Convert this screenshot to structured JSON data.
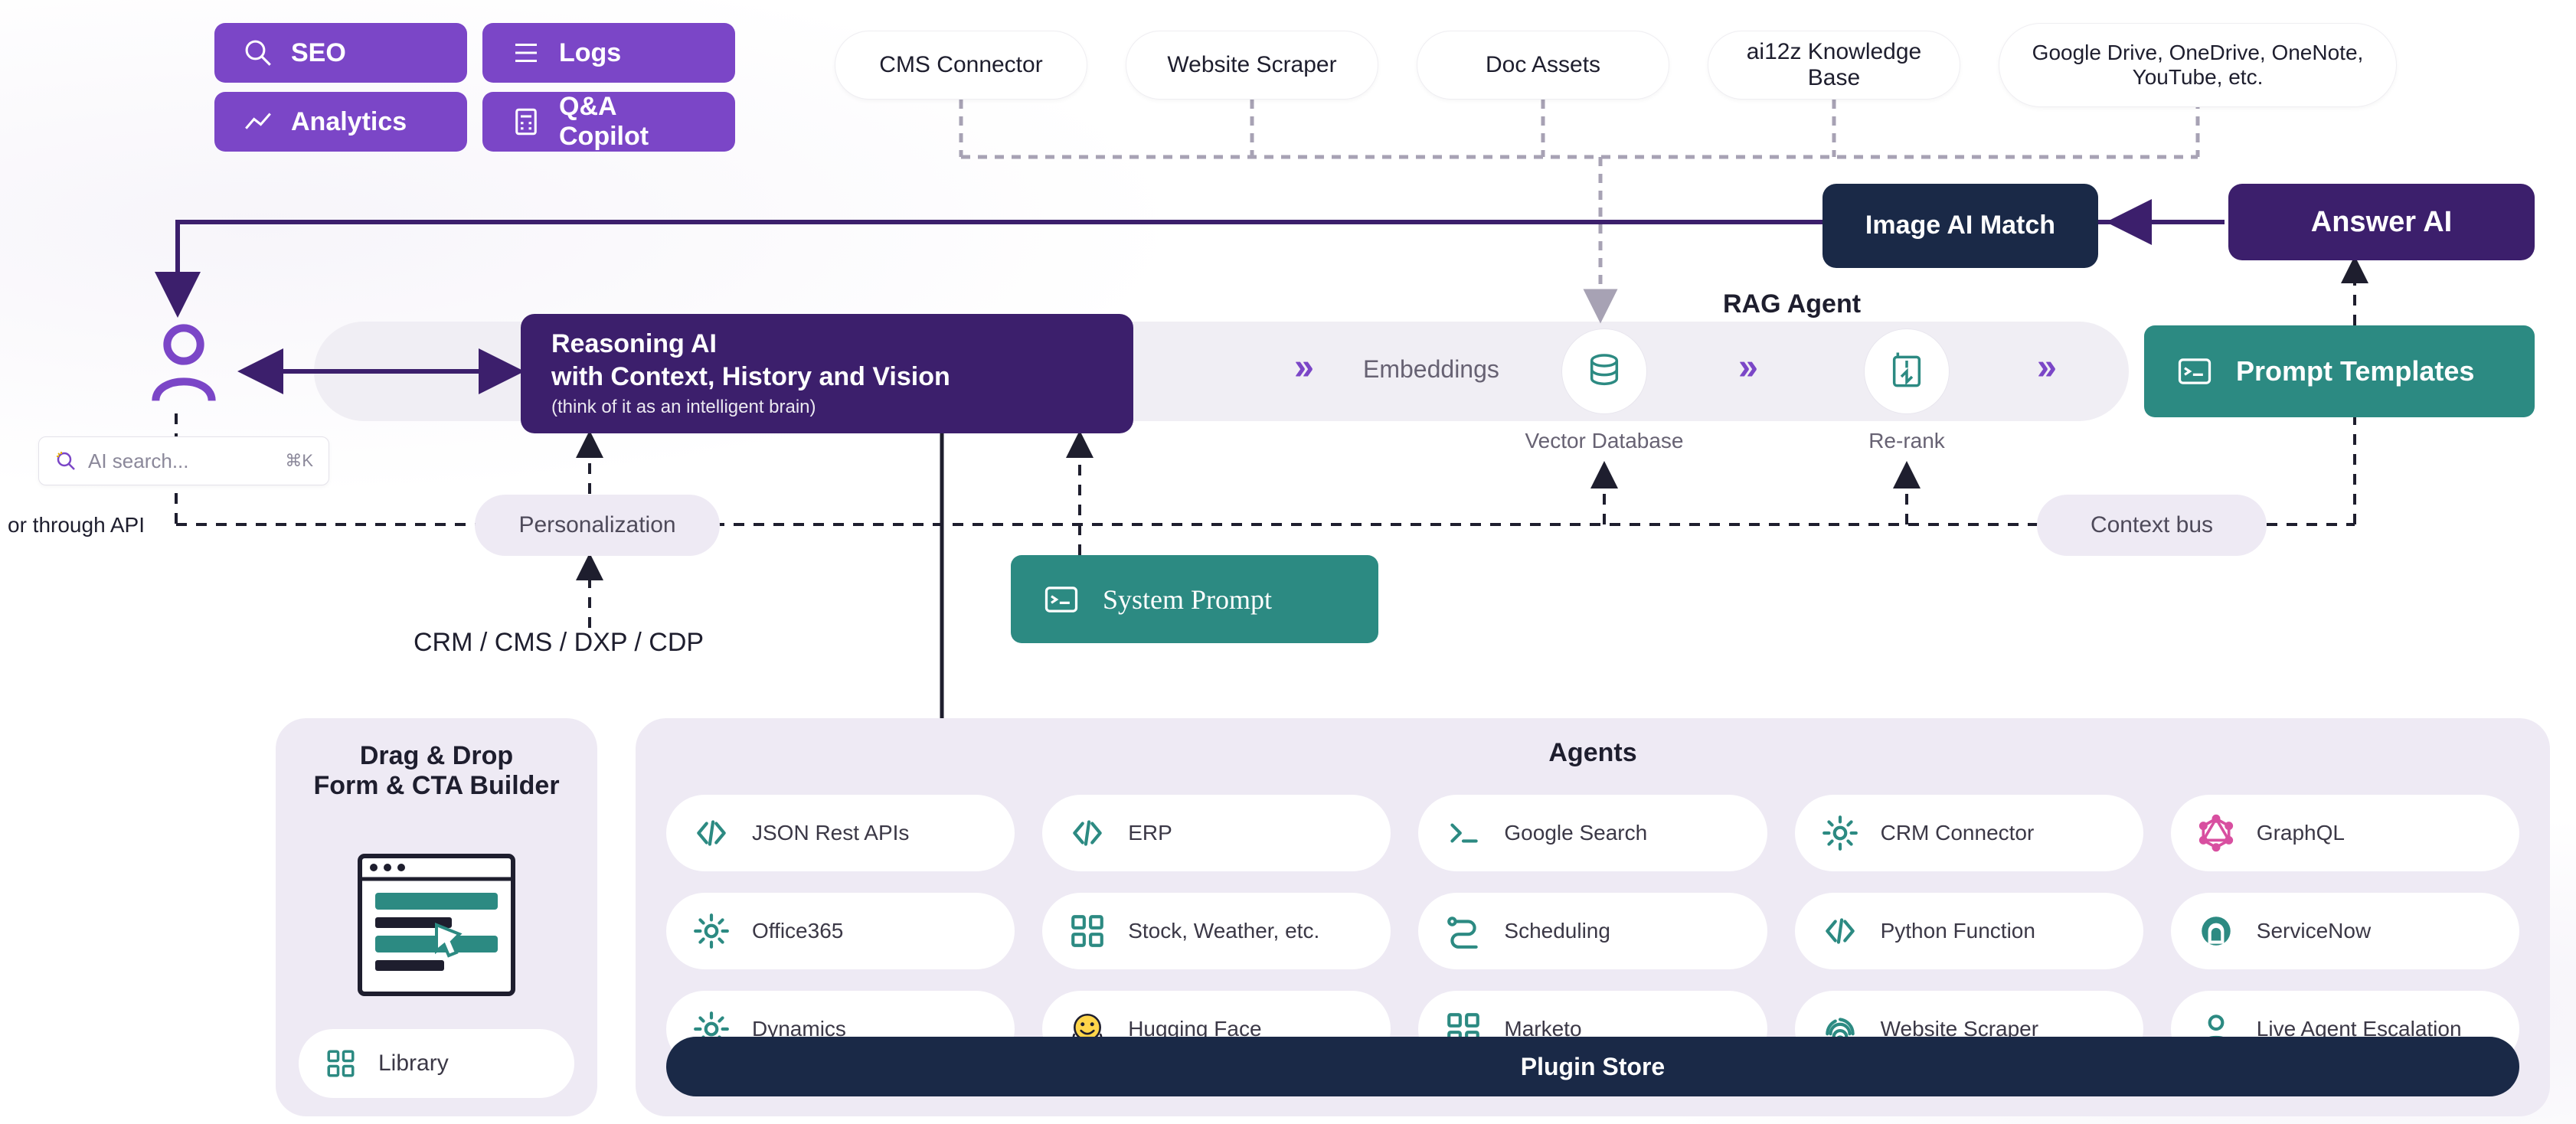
{
  "nav": {
    "seo": "SEO",
    "logs": "Logs",
    "analytics": "Analytics",
    "qa_copilot": "Q&A Copilot"
  },
  "sources": {
    "cms": "CMS Connector",
    "scraper": "Website Scraper",
    "doc": "Doc Assets",
    "kb": "ai12z Knowledge Base",
    "cloud": "Google Drive, OneDrive, OneNote, YouTube, etc."
  },
  "blocks": {
    "image_ai_match": "Image AI Match",
    "answer_ai": "Answer AI",
    "reasoning_l1": "Reasoning AI",
    "reasoning_l2": "with Context, History and Vision",
    "reasoning_l3": "(think of it as an intelligent brain)",
    "system_prompt": "System Prompt",
    "prompt_templates": "Prompt Templates"
  },
  "pipeline": {
    "embeddings": "Embeddings",
    "vector_db": "Vector Database",
    "rerank": "Re-rank",
    "rag_agent": "RAG Agent",
    "personalization": "Personalization",
    "context_bus": "Context bus"
  },
  "misc": {
    "api_text": "or through API",
    "search_placeholder": "AI search...",
    "search_shortcut": "⌘K",
    "crm_line": "CRM / CMS / DXP / CDP"
  },
  "form_builder": {
    "title_l1": "Drag & Drop",
    "title_l2": "Form & CTA Builder",
    "library": "Library"
  },
  "agents": {
    "title": "Agents",
    "plugin_store": "Plugin Store",
    "cards": [
      {
        "label": "JSON Rest APIs",
        "icon": "code"
      },
      {
        "label": "ERP",
        "icon": "code"
      },
      {
        "label": "Google Search",
        "icon": "terminal"
      },
      {
        "label": "CRM Connector",
        "icon": "gear"
      },
      {
        "label": "GraphQL",
        "icon": "graphql"
      },
      {
        "label": "Office365",
        "icon": "gear"
      },
      {
        "label": "Stock, Weather, etc.",
        "icon": "grid"
      },
      {
        "label": "Scheduling",
        "icon": "route"
      },
      {
        "label": "Python Function",
        "icon": "code"
      },
      {
        "label": "ServiceNow",
        "icon": "servicenow"
      },
      {
        "label": "Dynamics",
        "icon": "gear"
      },
      {
        "label": "Hugging Face",
        "icon": "huggingface"
      },
      {
        "label": "Marketo",
        "icon": "grid"
      },
      {
        "label": "Website Scraper",
        "icon": "fingerprint"
      },
      {
        "label": "Live Agent Escalation",
        "icon": "user"
      }
    ]
  }
}
